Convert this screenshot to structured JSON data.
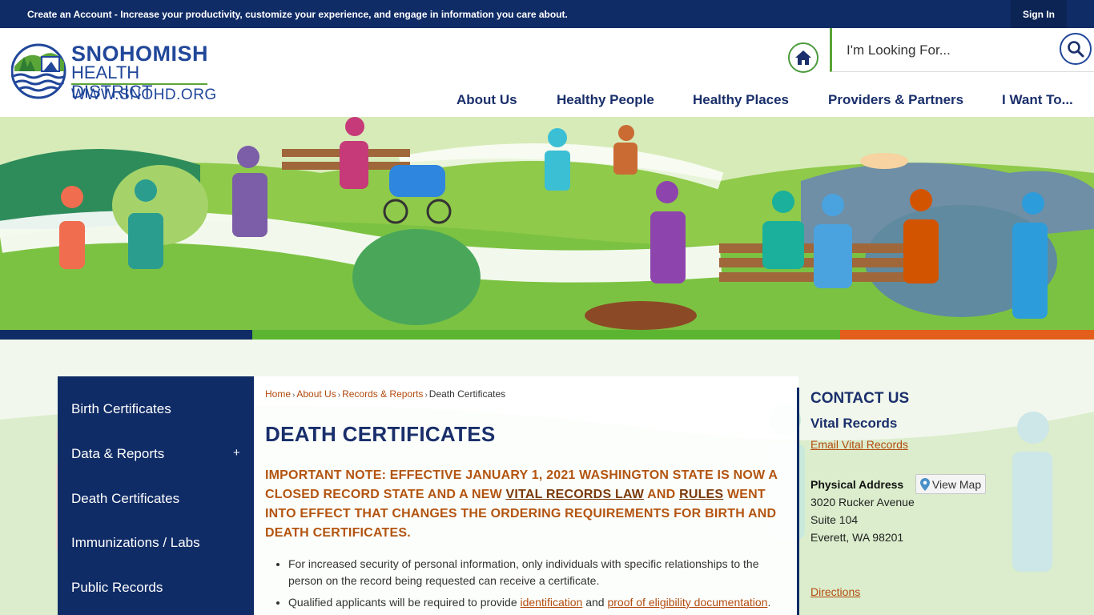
{
  "topbar": {
    "create_link": "Create an Account",
    "message": " - Increase your productivity, customize your experience, and engage in information you care about.",
    "signin": "Sign In"
  },
  "logo": {
    "line1": "SNOHOMISH",
    "line2": "HEALTH DISTRICT",
    "line3": "WWW.SNOHD.ORG"
  },
  "search": {
    "placeholder": "I'm Looking For..."
  },
  "nav": [
    "About Us",
    "Healthy People",
    "Healthy Places",
    "Providers & Partners",
    "I Want To..."
  ],
  "sidebar": {
    "items": [
      {
        "label": "Birth Certificates"
      },
      {
        "label": "Data & Reports",
        "expand": "+"
      },
      {
        "label": "Death Certificates"
      },
      {
        "label": "Immunizations / Labs"
      },
      {
        "label": "Public Records"
      }
    ]
  },
  "breadcrumb": {
    "items": [
      "Home",
      "About Us",
      "Records & Reports"
    ],
    "current": "Death Certificates",
    "sep": "›"
  },
  "page": {
    "title": "DEATH CERTIFICATES",
    "note_pre": "IMPORTANT NOTE: EFFECTIVE JANUARY 1, 2021 WASHINGTON STATE IS NOW A CLOSED RECORD STATE AND A NEW ",
    "note_link1": "VITAL RECORDS LAW",
    "note_mid": " AND ",
    "note_link2": "RULES",
    "note_post": " WENT INTO EFFECT THAT CHANGES THE ORDERING REQUIREMENTS FOR BIRTH AND DEATH CERTIFICATES.",
    "bullet1": "For increased security of personal information, only individuals with specific relationships to the person on the record being requested can receive a certificate.",
    "bullet2_pre": "Qualified applicants will be required to provide ",
    "bullet2_link1": "identification",
    "bullet2_mid": " and ",
    "bullet2_link2": "proof of eligibility documentation",
    "bullet2_post": "."
  },
  "contact": {
    "title": "CONTACT US",
    "subtitle": "Vital Records",
    "email_link": "Email Vital Records",
    "address_label": "Physical Address",
    "view_map": "View Map",
    "address": [
      "3020 Rucker Avenue",
      "Suite 104",
      "Everett, WA 98201"
    ],
    "directions": "Directions"
  },
  "colors": {
    "navy": "#102c66",
    "heading": "#1a2f6b",
    "accent_orange": "#b35410",
    "accent_green": "#5aa537"
  }
}
